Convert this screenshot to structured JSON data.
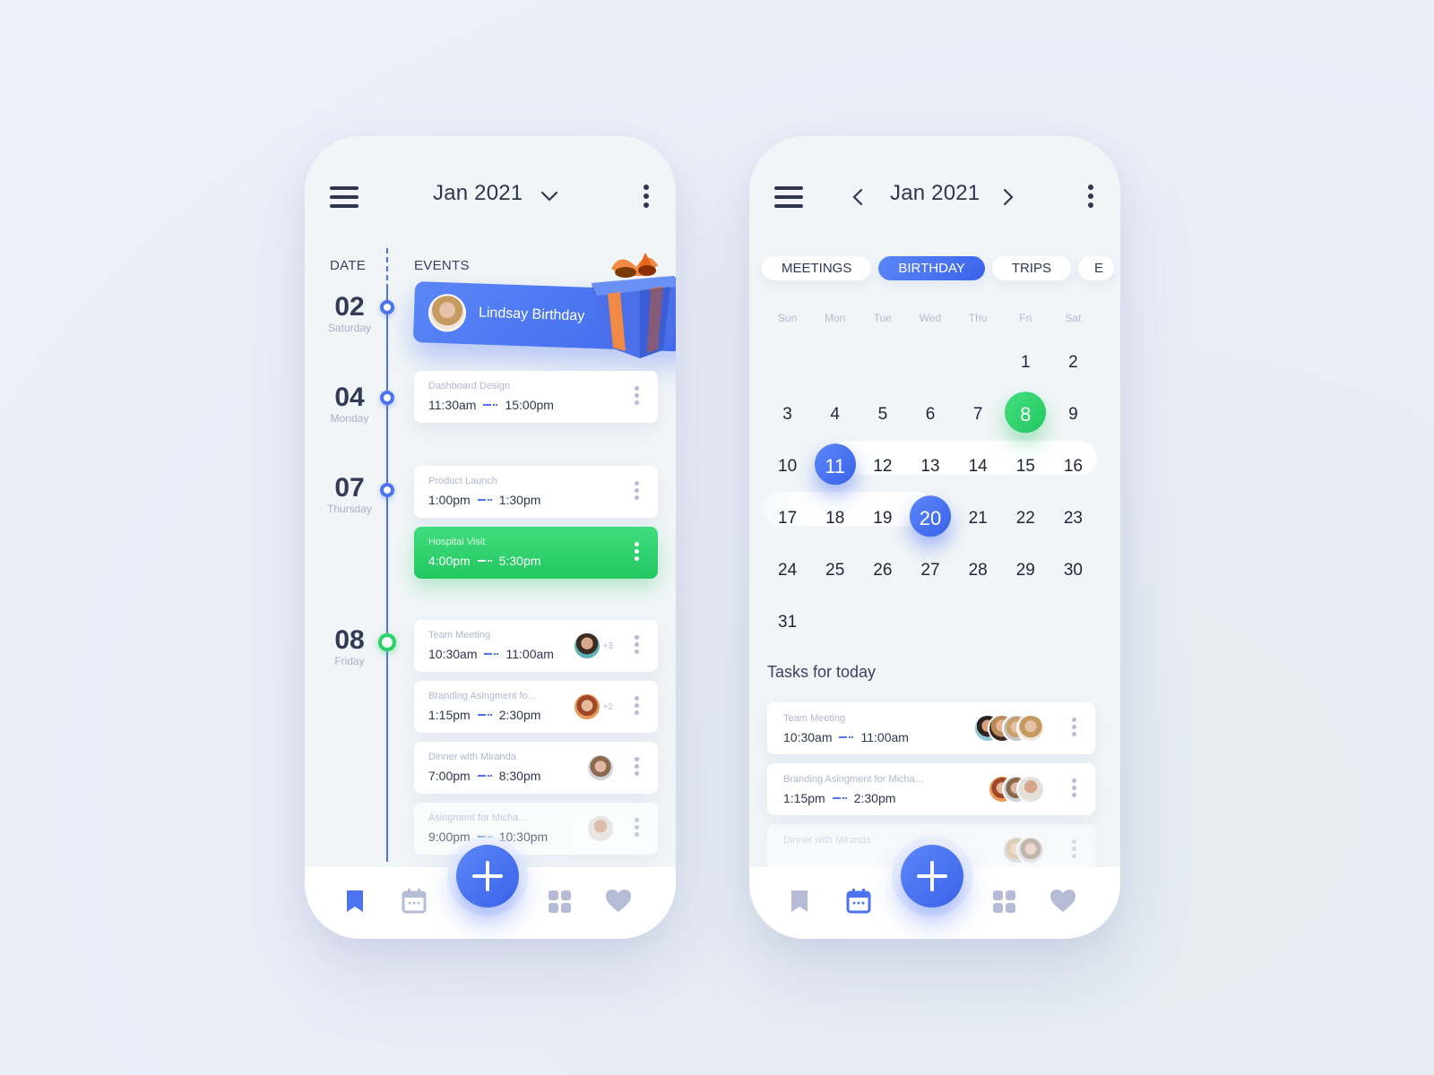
{
  "colors": {
    "accent_blue": "#4d74f0",
    "accent_green": "#2bd166",
    "text_dark": "#2f3650",
    "text_muted": "#b1b6cf"
  },
  "left_screen": {
    "header": {
      "title": "Jan 2021",
      "menu_icon": "hamburger-icon",
      "dropdown_icon": "chevron-down-icon",
      "more_icon": "kebab-icon"
    },
    "columns": {
      "date": "DATE",
      "events": "EVENTS"
    },
    "dates": [
      {
        "num": "02",
        "day": "Saturday"
      },
      {
        "num": "04",
        "day": "Monday"
      },
      {
        "num": "07",
        "day": "Thursday"
      },
      {
        "num": "08",
        "day": "Friday"
      }
    ],
    "birthday": {
      "label": "Lindsay Birthday",
      "icon": "gift-icon"
    },
    "events": [
      {
        "title": "Dashboard Design",
        "start": "11:30am",
        "end": "15:00pm"
      },
      {
        "title": "Product Launch",
        "start": "1:00pm",
        "end": "1:30pm"
      },
      {
        "title": "Hospital Visit",
        "start": "4:00pm",
        "end": "5:30pm"
      },
      {
        "title": "Team Meeting",
        "start": "10:30am",
        "end": "11:00am",
        "extra": "+3"
      },
      {
        "title": "Branding Asingment fo...",
        "start": "1:15pm",
        "end": "2:30pm",
        "extra": "+2"
      },
      {
        "title": "Dinner with Miranda",
        "start": "7:00pm",
        "end": "8:30pm"
      },
      {
        "title": "Asingment for Micha...",
        "start": "9:00pm",
        "end": "10:30pm"
      }
    ],
    "bottom_nav": {
      "active": "bookmark",
      "items": [
        "bookmark-icon",
        "calendar-icon",
        "add-icon",
        "grid-icon",
        "heart-icon"
      ]
    }
  },
  "right_screen": {
    "header": {
      "title": "Jan 2021",
      "prev_icon": "chevron-left-icon",
      "next_icon": "chevron-right-icon"
    },
    "chips": [
      "MEETINGS",
      "BIRTHDAY",
      "TRIPS",
      "E"
    ],
    "active_chip": "BIRTHDAY",
    "weekdays": [
      "Sun",
      "Mon",
      "Tue",
      "Wed",
      "Thu",
      "Fri",
      "Sat"
    ],
    "first_weekday_index": 5,
    "days_in_month": 31,
    "highlight_green": [
      8
    ],
    "highlight_blue": [
      11,
      20
    ],
    "tasks_title": "Tasks for today",
    "tasks": [
      {
        "title": "Team Meeting",
        "start": "10:30am",
        "end": "11:00am"
      },
      {
        "title": "Branding Asingment for Micha...",
        "start": "1:15pm",
        "end": "2:30pm"
      },
      {
        "title": "Dinner with Miranda"
      }
    ],
    "bottom_nav": {
      "active": "calendar"
    }
  }
}
